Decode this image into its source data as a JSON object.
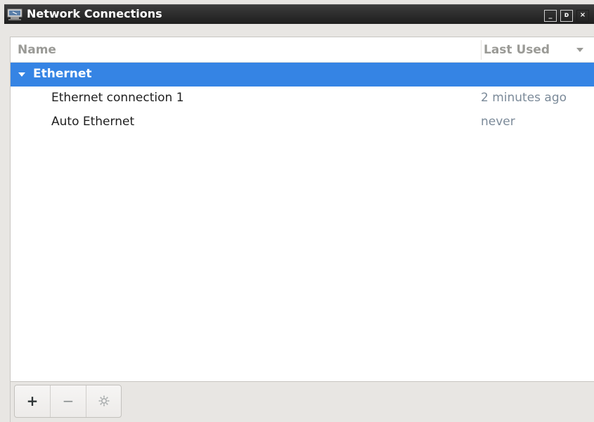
{
  "window": {
    "title": "Network Connections",
    "minimize_glyph": "_",
    "maximize_glyph": "ᴅ",
    "close_glyph": "×"
  },
  "list": {
    "columns": {
      "name": "Name",
      "last_used": "Last Used"
    },
    "groups": [
      {
        "label": "Ethernet",
        "connections": [
          {
            "name": "Ethernet connection 1",
            "last_used": "2 minutes ago"
          },
          {
            "name": "Auto Ethernet",
            "last_used": "never"
          }
        ]
      }
    ]
  },
  "toolbar": {
    "add_label": "+",
    "remove_label": "−"
  },
  "colors": {
    "selection": "#3584e4",
    "titlebar": "#2a2a2a",
    "secondary_text": "#7b8a99"
  },
  "icons": {
    "app": "network-icon",
    "sort": "sort-descending-icon",
    "expander": "expander-down-icon",
    "settings": "gear-icon"
  }
}
